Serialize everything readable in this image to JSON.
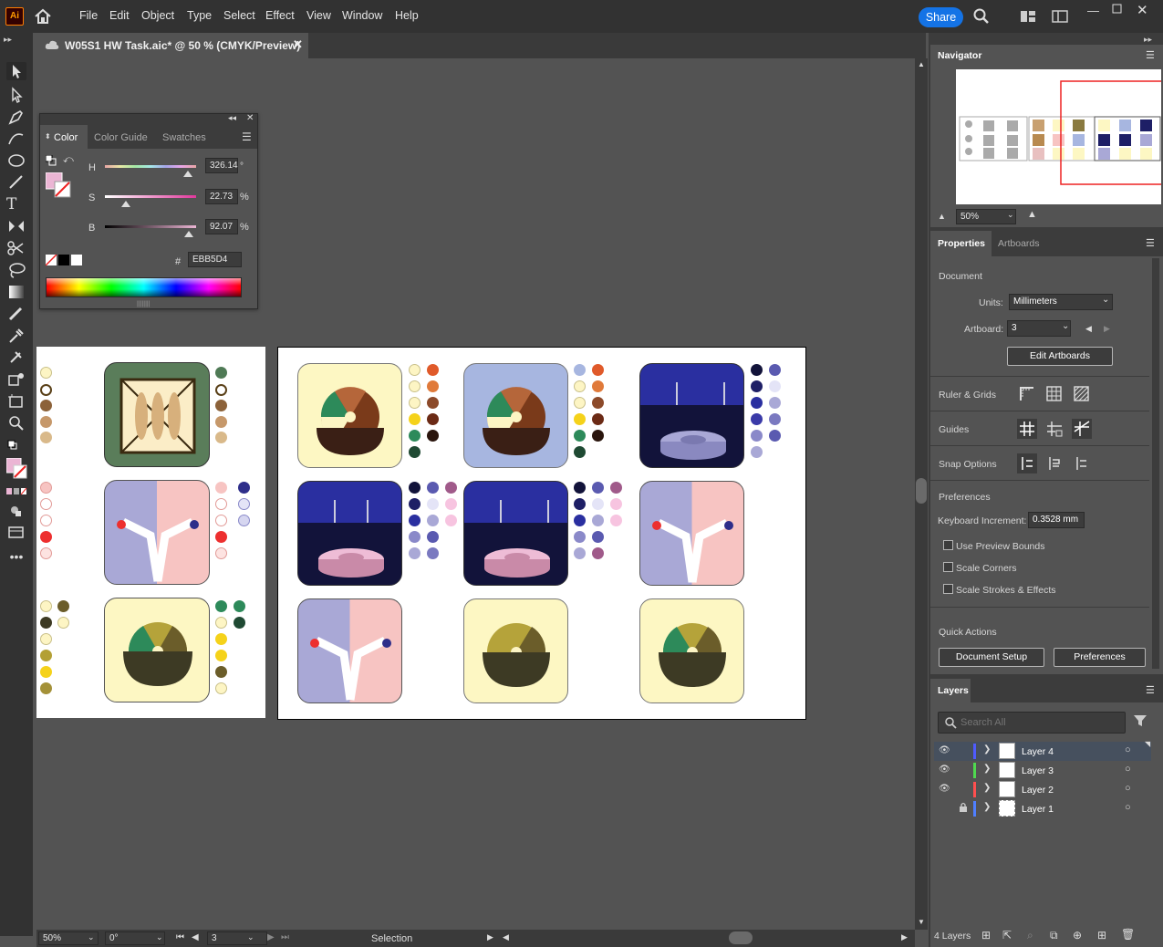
{
  "app": {
    "logo": "Ai",
    "menu": [
      "File",
      "Edit",
      "Object",
      "Type",
      "Select",
      "Effect",
      "View",
      "Window",
      "Help"
    ],
    "share": "Share"
  },
  "document": {
    "tab_title": "W05S1 HW Task.aic* @ 50 % (CMYK/Preview)"
  },
  "color_panel": {
    "tabs": [
      "Color",
      "Color Guide",
      "Swatches"
    ],
    "h_label": "H",
    "s_label": "S",
    "b_label": "B",
    "h_value": "326.14",
    "s_value": "22.73",
    "b_value": "92.07",
    "h_unit": "°",
    "s_unit": "%",
    "b_unit": "%",
    "hex_label": "#",
    "hex_value": "EBB5D4",
    "fill_color": "#ebb5d4",
    "h": 326.14,
    "s": 22.73,
    "b": 92.07
  },
  "navigator": {
    "title": "Navigator",
    "zoom": "50%"
  },
  "properties": {
    "tabs": [
      "Properties",
      "Artboards"
    ],
    "document_label": "Document",
    "units_label": "Units:",
    "units_value": "Millimeters",
    "artboard_label": "Artboard:",
    "artboard_value": "3",
    "edit_artboards": "Edit Artboards",
    "ruler_grids": "Ruler & Grids",
    "guides": "Guides",
    "snap_options": "Snap Options",
    "preferences_heading": "Preferences",
    "keyboard_increment_label": "Keyboard Increment:",
    "keyboard_increment_value": "0.3528 mm",
    "checkboxes": [
      "Use Preview Bounds",
      "Scale Corners",
      "Scale Strokes & Effects"
    ],
    "quick_actions": "Quick Actions",
    "document_setup": "Document Setup",
    "preferences_button": "Preferences"
  },
  "layers": {
    "title": "Layers",
    "search_placeholder": "Search All",
    "items": [
      {
        "name": "Layer 4",
        "color": "#4f5bff",
        "visible": true,
        "locked": false,
        "selected": true
      },
      {
        "name": "Layer 3",
        "color": "#4fd94f",
        "visible": true,
        "locked": false,
        "selected": false
      },
      {
        "name": "Layer 2",
        "color": "#ff4f4f",
        "visible": true,
        "locked": false,
        "selected": false
      },
      {
        "name": "Layer 1",
        "color": "#4f7fff",
        "visible": false,
        "locked": true,
        "selected": false
      }
    ],
    "count": "4 Layers"
  },
  "status": {
    "zoom": "50%",
    "rotation": "0°",
    "artboard": "3",
    "tool": "Selection"
  },
  "colors": {
    "accent": "#1473e6",
    "cream": "#fdf7c3",
    "periwinkle": "#a7b6e0",
    "navy": "#1e1f66",
    "pink": "#f7c4c2",
    "lavender": "#a9a8d6",
    "green_tile": "#5a7d5a"
  }
}
